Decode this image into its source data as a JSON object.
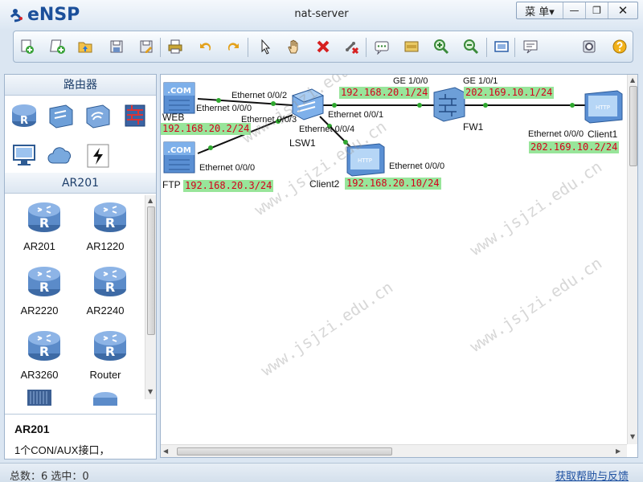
{
  "window": {
    "app_name": "eNSP",
    "title": "nat-server",
    "menu_label": "菜 单▾",
    "minimize_label": "—",
    "restore_label": "❐",
    "close_label": "✕"
  },
  "toolbar": {
    "icons": [
      "new-topology-icon",
      "new-example-icon",
      "open-icon",
      "save-icon",
      "save-as-icon",
      "print-icon",
      "undo-icon",
      "redo-icon",
      "select-icon",
      "drag-hand-icon",
      "delete-icon",
      "delete-links-icon",
      "text-label-icon",
      "palette-icon",
      "zoom-in-icon",
      "zoom-out-icon",
      "fit-view-icon",
      "console-icon",
      "huawei-forum-icon",
      "settings-icon",
      "help-icon"
    ]
  },
  "left_panel": {
    "category_header": "路由器",
    "device_header": "AR201",
    "devices": [
      {
        "label": "AR201"
      },
      {
        "label": "AR1220"
      },
      {
        "label": "AR2220"
      },
      {
        "label": "AR2240"
      },
      {
        "label": "AR3260"
      },
      {
        "label": "Router"
      }
    ],
    "info_title": "AR201",
    "info_desc": "1个CON/AUX接口，"
  },
  "topology": {
    "devices": {
      "web": "WEB",
      "ftp": "FTP",
      "lsw1": "LSW1",
      "client2": "Client2",
      "fw1": "FW1",
      "client1": "Client1"
    },
    "ports": {
      "web_e0": "Ethernet 0/0/0",
      "lsw_e2": "Ethernet 0/0/2",
      "lsw_e3": "Ethernet 0/0/3",
      "lsw_e1": "Ethernet 0/0/1",
      "lsw_e4": "Ethernet 0/0/4",
      "ftp_e0": "Ethernet 0/0/0",
      "client2_e0": "Ethernet 0/0/0",
      "fw_ge100": "GE 1/0/0",
      "fw_ge101": "GE 1/0/1",
      "client1_e0": "Ethernet 0/0/0"
    },
    "ips": {
      "web": "192.168.20.2/24",
      "ftp": "192.168.20.3/24",
      "client2": "192.168.20.10/24",
      "fw_inside": "192.168.20.1/24",
      "fw_outside": "202.169.10.1/24",
      "client1": "202.169.10.2/24"
    },
    "device_screen_text": {
      "com": ".COM",
      "http": "HTTP"
    },
    "watermark": "www.jsjzi.edu.cn"
  },
  "statusbar": {
    "left": "总数：6  选中：0",
    "right": "获取帮助与反馈"
  }
}
